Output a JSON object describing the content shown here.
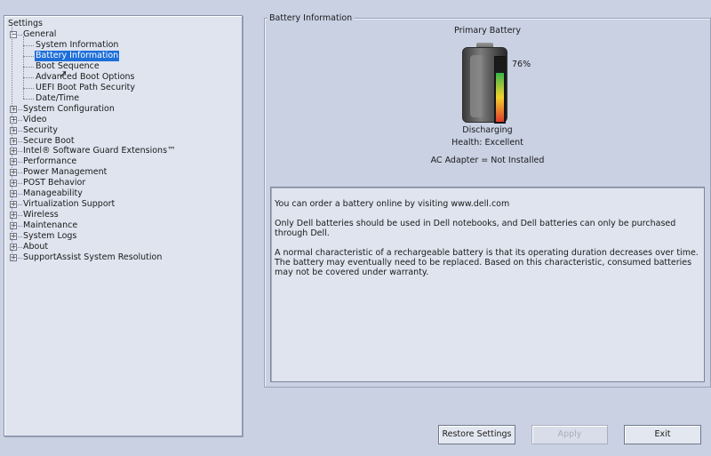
{
  "tree": {
    "title": "Settings",
    "items": [
      {
        "label": "General",
        "level": 0,
        "expanded": true
      },
      {
        "label": "System Information",
        "level": 1
      },
      {
        "label": "Battery Information",
        "level": 1,
        "selected": true
      },
      {
        "label": "Boot Sequence",
        "level": 1
      },
      {
        "label": "Advanced Boot Options",
        "level": 1
      },
      {
        "label": "UEFI Boot Path Security",
        "level": 1
      },
      {
        "label": "Date/Time",
        "level": 1
      },
      {
        "label": "System Configuration",
        "level": 0
      },
      {
        "label": "Video",
        "level": 0
      },
      {
        "label": "Security",
        "level": 0
      },
      {
        "label": "Secure Boot",
        "level": 0
      },
      {
        "label": "Intel® Software Guard Extensions™",
        "level": 0
      },
      {
        "label": "Performance",
        "level": 0
      },
      {
        "label": "Power Management",
        "level": 0
      },
      {
        "label": "POST Behavior",
        "level": 0
      },
      {
        "label": "Manageability",
        "level": 0
      },
      {
        "label": "Virtualization Support",
        "level": 0
      },
      {
        "label": "Wireless",
        "level": 0
      },
      {
        "label": "Maintenance",
        "level": 0
      },
      {
        "label": "System Logs",
        "level": 0
      },
      {
        "label": "About",
        "level": 0
      },
      {
        "label": "SupportAssist System Resolution",
        "level": 0
      }
    ]
  },
  "battery": {
    "section_title": "Battery Information",
    "name": "Primary Battery",
    "charge_percent_label": "76%",
    "charge_fraction": 0.76,
    "status": "Discharging",
    "health": "Health: Excellent",
    "ac_adapter": "AC Adapter = Not Installed"
  },
  "info": {
    "lines": [
      "You can order a battery online by visiting www.dell.com",
      "Only Dell batteries should be used in Dell notebooks, and Dell batteries can only be purchased through Dell.",
      "A normal characteristic of a rechargeable battery is that its operating duration decreases over time.  The battery may eventually need to be replaced.  Based on this characteristic, consumed batteries may not be covered under warranty."
    ]
  },
  "buttons": {
    "restore": "Restore Settings",
    "apply": "Apply",
    "exit": "Exit"
  },
  "colors": {
    "background": "#c9d1e3",
    "selection": "#1e6fd9"
  }
}
